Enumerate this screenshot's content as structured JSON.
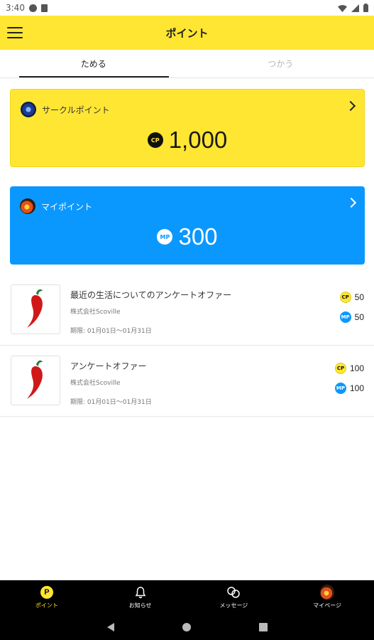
{
  "status_bar": {
    "time": "3:40"
  },
  "app_bar": {
    "title": "ポイント",
    "menu_icon": "hamburger-menu-icon"
  },
  "tabs": [
    {
      "label": "ためる",
      "active": true
    },
    {
      "label": "つかう",
      "active": false
    }
  ],
  "circle_point": {
    "label": "サークルポイント",
    "badge": "CP",
    "amount": "1,000",
    "color": "#ffe632"
  },
  "my_point": {
    "label": "マイポイント",
    "badge": "MP",
    "amount": "300",
    "color": "#0a98ff"
  },
  "offers": [
    {
      "title": "最近の生活についてのアンケートオファー",
      "company": "株式会社Scoville",
      "period": "期限: 01月01日～01月31日",
      "cp_badge": "CP",
      "cp": "50",
      "mp_badge": "MP",
      "mp": "50"
    },
    {
      "title": "アンケートオファー",
      "company": "株式会社Scoville",
      "period": "期限: 01月01日～01月31日",
      "cp_badge": "CP",
      "cp": "100",
      "mp_badge": "MP",
      "mp": "100"
    }
  ],
  "bottom_nav": [
    {
      "label": "ポイント",
      "icon": "point-icon",
      "glyph": "P",
      "active": true
    },
    {
      "label": "お知らせ",
      "icon": "bell-icon",
      "active": false
    },
    {
      "label": "メッセージ",
      "icon": "message-icon",
      "active": false
    },
    {
      "label": "マイページ",
      "icon": "avatar-icon",
      "active": false
    }
  ]
}
